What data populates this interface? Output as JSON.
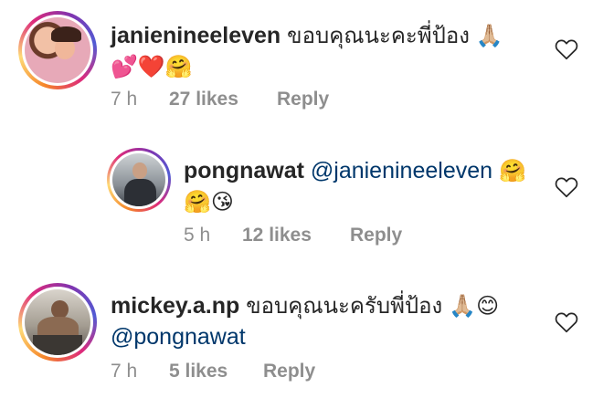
{
  "comments": [
    {
      "username": "janienineeleven",
      "text": "ขอบคุณนะคะพี่ป้อง",
      "emoji_line1": "🙏🏼",
      "emoji_line2": "💕❤️🤗",
      "time": "7 h",
      "likes": "27 likes",
      "reply": "Reply"
    },
    {
      "username": "pongnawat",
      "mention": "@janienineeleven",
      "emoji_line1": "🤗",
      "emoji_line2": "🤗😘",
      "time": "5 h",
      "likes": "12 likes",
      "reply": "Reply"
    },
    {
      "username": "mickey.a.np",
      "text": "ขอบคุณนะครับพี่ป้อง",
      "emoji_line1": "🙏🏼😊",
      "mention": "@pongnawat",
      "time": "7 h",
      "likes": "5 likes",
      "reply": "Reply"
    }
  ],
  "colors": {
    "text": "#262626",
    "meta": "#8e8e8e",
    "mention": "#00376b"
  },
  "icons": [
    "heart-outline-icon"
  ]
}
